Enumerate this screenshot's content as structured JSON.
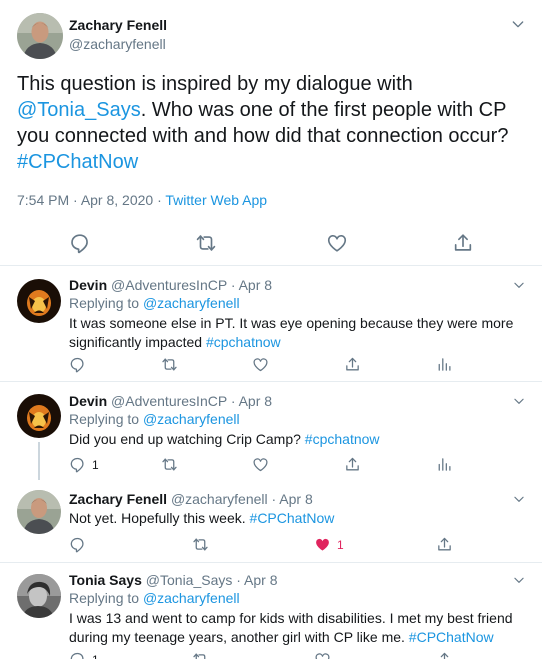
{
  "main_tweet": {
    "author_name": "Zachary Fenell",
    "author_handle": "@zacharyfenell",
    "text_part1": "This question is inspired by my dialogue with ",
    "mention": "@Tonia_Says",
    "text_part2": ". Who was one of the first people with CP you connected with and how did that connection occur? ",
    "hashtag": "#CPChatNow",
    "time": "7:54 PM",
    "separator": " · ",
    "date": "Apr 8, 2020",
    "source": "Twitter Web App"
  },
  "replies": [
    {
      "author_name": "Devin",
      "author_handle": "@AdventuresInCP",
      "date": "· Apr 8",
      "replying_label": "Replying to ",
      "replying_to": "@zacharyfenell",
      "text": "It was someone else in PT. It was eye opening because they were more significantly impacted ",
      "hashtag": "#cpchatnow",
      "reply_count": "",
      "like_count": ""
    },
    {
      "author_name": "Devin",
      "author_handle": "@AdventuresInCP",
      "date": "· Apr 8",
      "replying_label": "Replying to ",
      "replying_to": "@zacharyfenell",
      "text": "Did you end up watching Crip Camp? ",
      "hashtag": "#cpchatnow",
      "reply_count": "1",
      "like_count": ""
    },
    {
      "author_name": "Zachary Fenell",
      "author_handle": "@zacharyfenell",
      "date": "· Apr 8",
      "text": "Not yet. Hopefully this week. ",
      "hashtag": "#CPChatNow",
      "reply_count": "",
      "like_count": "1"
    },
    {
      "author_name": "Tonia Says",
      "author_handle": "@Tonia_Says",
      "date": "· Apr 8",
      "replying_label": "Replying to ",
      "replying_to": "@zacharyfenell",
      "text": "I was 13 and went to camp for kids with disabilities.  I met my best friend during my teenage years, another girl with CP like me. ",
      "hashtag": "#CPChatNow",
      "reply_count": "1",
      "like_count": ""
    }
  ],
  "colors": {
    "link": "#1b95e0",
    "muted": "#657786",
    "like_active": "#e0245e",
    "divider": "#e6ecf0"
  },
  "icons": [
    "chevron-down-icon",
    "reply-icon",
    "retweet-icon",
    "like-icon",
    "share-icon",
    "analytics-icon"
  ]
}
